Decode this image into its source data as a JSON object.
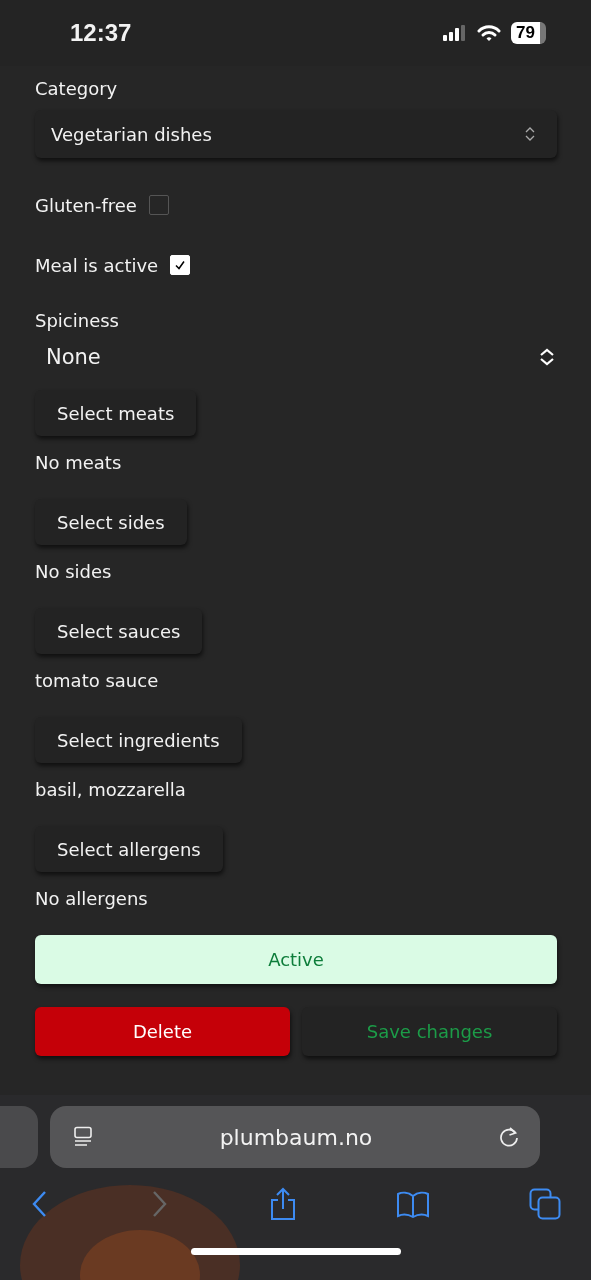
{
  "status_bar": {
    "time": "12:37",
    "battery": "79"
  },
  "category": {
    "label": "Category",
    "value": "Vegetarian dishes"
  },
  "checkboxes": [
    {
      "label": "Gluten-free",
      "checked": false
    },
    {
      "label": "Meal is active",
      "checked": true
    }
  ],
  "spiciness": {
    "label": "Spiciness",
    "value": "None"
  },
  "pickers": [
    {
      "button": "Select meats",
      "summary": "No meats"
    },
    {
      "button": "Select sides",
      "summary": "No sides"
    },
    {
      "button": "Select sauces",
      "summary": "tomato sauce"
    },
    {
      "button": "Select ingredients",
      "summary": "basil, mozzarella"
    },
    {
      "button": "Select allergens",
      "summary": "No allergens"
    }
  ],
  "status_button": {
    "label": "Active",
    "on": true
  },
  "actions": [
    {
      "kind": "danger",
      "label": "Delete"
    },
    {
      "kind": "save",
      "label": "Save changes"
    }
  ],
  "browser": {
    "url": "plumbaum.no",
    "forward_disabled": true
  }
}
